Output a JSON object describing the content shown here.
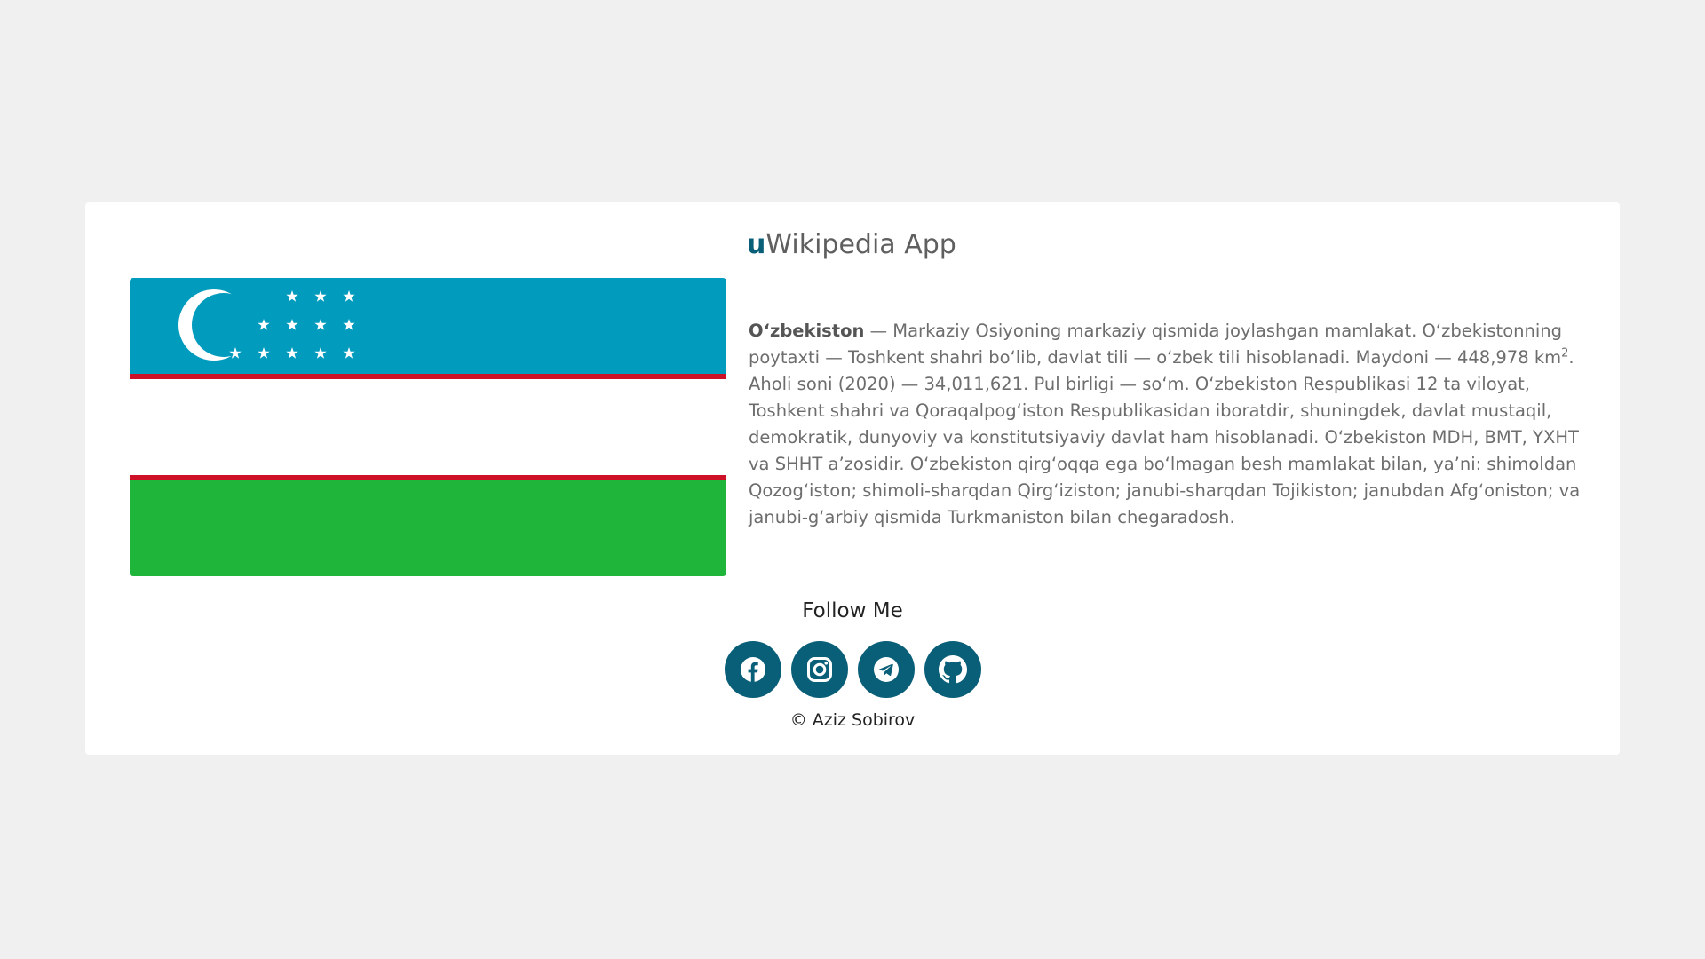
{
  "app": {
    "title_accent": "u",
    "title_rest": "Wikipedia App"
  },
  "article": {
    "term": "O‘zbekiston",
    "text_before_unit": " — Markaziy Osiyoning markaziy qismida joylashgan mamlakat. O‘zbekistonning poytaxti — Toshkent shahri bo‘lib, davlat tili — o‘zbek tili hisoblanadi. Maydoni — 448,978 km",
    "unit_power": "2",
    "text_after_unit": ". Aholi soni (2020) — 34,011,621. Pul birligi — so‘m. O‘zbekiston Respublikasi 12 ta viloyat, Toshkent shahri va Qoraqalpog‘iston Respublikasidan iboratdir, shuningdek, davlat mustaqil, demokratik, dunyoviy va konstitutsiyaviy davlat ham hisoblanadi. O‘zbekiston MDH, BMT, YXHT va SHHT a’zosidir. O‘zbekiston qirg‘oqqa ega bo‘lmagan besh mamlakat bilan, ya’ni: shimoldan Qozog‘iston; shimoli-sharqdan Qirg‘iziston; janubi-sharqdan Tojikiston; janubdan Afg‘oniston; va janubi-g‘arbiy qismida Turkmaniston bilan chegaradosh."
  },
  "flag": {
    "icon": "uzbekistan-flag",
    "colors": {
      "blue": "#009bbd",
      "white": "#ffffff",
      "red": "#ce1126",
      "green": "#1eb53a"
    }
  },
  "footer": {
    "follow_label": "Follow Me",
    "socials": [
      {
        "icon": "facebook-icon"
      },
      {
        "icon": "instagram-icon"
      },
      {
        "icon": "telegram-icon"
      },
      {
        "icon": "github-icon"
      }
    ],
    "copyright": "© Aziz Sobirov"
  },
  "colors": {
    "accent": "#0a5f78",
    "page_background": "#f0f0f0",
    "card_background": "#ffffff"
  }
}
